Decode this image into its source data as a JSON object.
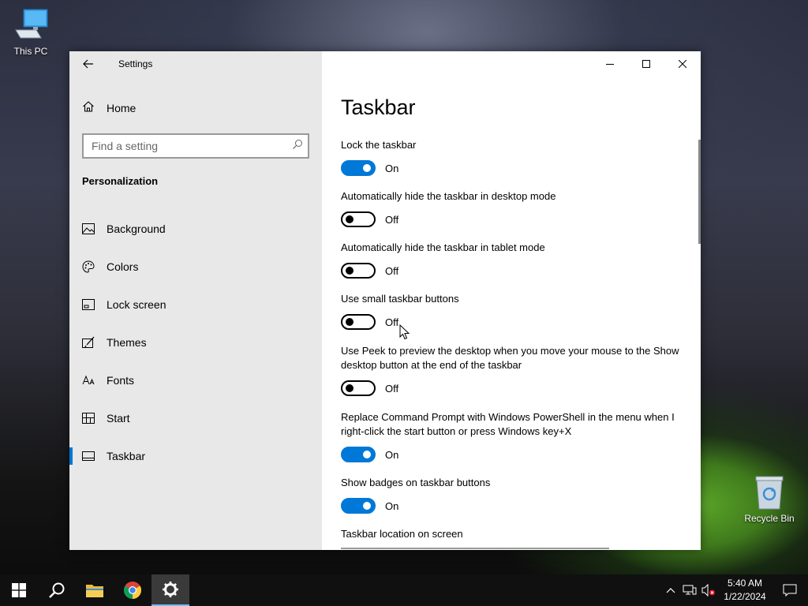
{
  "desktop": {
    "this_pc_label": "This PC",
    "recycle_bin_label": "Recycle Bin"
  },
  "window": {
    "app_title": "Settings",
    "home_label": "Home",
    "search_placeholder": "Find a setting",
    "section_title": "Personalization",
    "nav_items": [
      {
        "label": "Background",
        "icon": "background-icon"
      },
      {
        "label": "Colors",
        "icon": "palette-icon"
      },
      {
        "label": "Lock screen",
        "icon": "lock-screen-icon"
      },
      {
        "label": "Themes",
        "icon": "themes-icon"
      },
      {
        "label": "Fonts",
        "icon": "fonts-icon"
      },
      {
        "label": "Start",
        "icon": "start-icon"
      },
      {
        "label": "Taskbar",
        "icon": "taskbar-icon",
        "selected": true
      }
    ],
    "page_title": "Taskbar",
    "settings": [
      {
        "label": "Lock the taskbar",
        "state": "On"
      },
      {
        "label": "Automatically hide the taskbar in desktop mode",
        "state": "Off"
      },
      {
        "label": "Automatically hide the taskbar in tablet mode",
        "state": "Off"
      },
      {
        "label": "Use small taskbar buttons",
        "state": "Off"
      },
      {
        "label": "Use Peek to preview the desktop when you move your mouse to the Show desktop button at the end of the taskbar",
        "state": "Off"
      },
      {
        "label": "Replace Command Prompt with Windows PowerShell in the menu when I right-click the start button or press Windows key+X",
        "state": "On"
      },
      {
        "label": "Show badges on taskbar buttons",
        "state": "On"
      }
    ],
    "location_label": "Taskbar location on screen"
  },
  "taskbar": {
    "time": "5:40 AM",
    "date": "1/22/2024"
  },
  "colors": {
    "accent": "#0078d7",
    "sidebar_bg": "#e8e8e8",
    "taskbar_bg": "#101010"
  }
}
